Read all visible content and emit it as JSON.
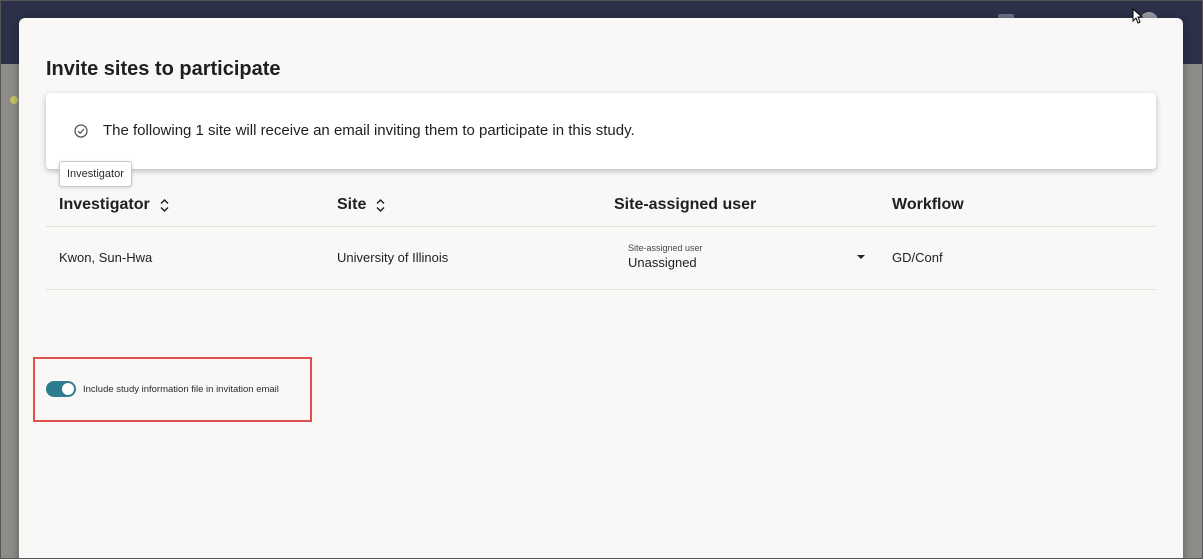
{
  "dialog": {
    "title": "Invite sites to participate",
    "notice": "The following 1 site will receive an email inviting them to participate in this study.",
    "tooltip": "Investigator"
  },
  "table": {
    "columns": {
      "investigator": "Investigator",
      "site": "Site",
      "site_assigned_user": "Site-assigned user",
      "workflow": "Workflow"
    },
    "rows": [
      {
        "investigator": "Kwon, Sun-Hwa",
        "site": "University of Illinois",
        "site_assigned_user_label": "Site-assigned user",
        "site_assigned_user_value": "Unassigned",
        "workflow": "GD/Conf"
      }
    ]
  },
  "toggle": {
    "label": "Include study information file in invitation email",
    "checked": true
  },
  "colors": {
    "accent": "#2f7c8e",
    "highlight": "#e0504f",
    "header": "#2c3149"
  },
  "icons": [
    "check-circle-icon",
    "sort-icon",
    "chevron-down-icon"
  ]
}
